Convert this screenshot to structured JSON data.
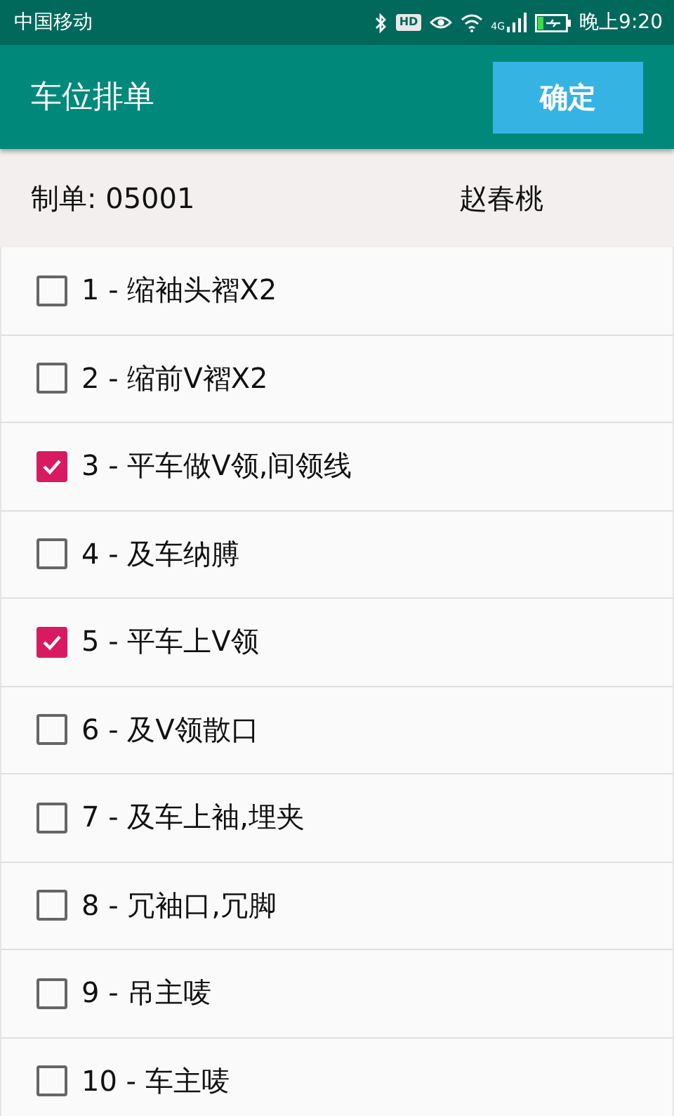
{
  "status_bar": {
    "carrier": "中国移动",
    "hd_label": "HD",
    "network_label": "4G",
    "time": "晚上9:20"
  },
  "app_bar": {
    "title": "车位排单",
    "confirm_button": "确定"
  },
  "header": {
    "order": "制单: 05001",
    "worker": "赵春桃"
  },
  "items": [
    {
      "label": "1 - 缩袖头褶X2",
      "checked": false
    },
    {
      "label": "2 - 缩前V褶X2",
      "checked": false
    },
    {
      "label": "3 - 平车做V领,间领线",
      "checked": true
    },
    {
      "label": "4 - 及车纳膊",
      "checked": false
    },
    {
      "label": "5 - 平车上V领",
      "checked": true
    },
    {
      "label": "6 - 及V领散口",
      "checked": false
    },
    {
      "label": "7 - 及车上袖,埋夹",
      "checked": false
    },
    {
      "label": "8 - 冗袖口,冗脚",
      "checked": false
    },
    {
      "label": "9 - 吊主唛",
      "checked": false
    },
    {
      "label": "10 - 车主唛",
      "checked": false
    }
  ]
}
